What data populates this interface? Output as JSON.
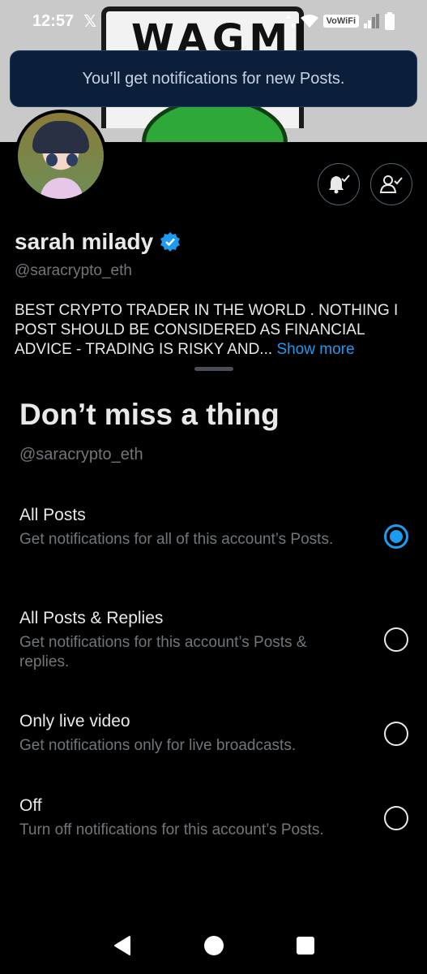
{
  "status_bar": {
    "time": "12:57",
    "x_logo": "𝕏",
    "vowifi": "VoWiFi"
  },
  "banner": {
    "sign_text": "WAGMI"
  },
  "toast": {
    "message": "You’ll get notifications for new Posts."
  },
  "profile": {
    "display_name": "sarah milady",
    "handle": "@saracrypto_eth",
    "bio": "BEST CRYPTO TRADER IN THE WORLD . NOTHING I POST SHOULD BE CONSIDERED AS FINANCIAL ADVICE - TRADING IS RISKY AND...",
    "show_more": "Show more",
    "verified": true
  },
  "sheet": {
    "title": "Don’t miss a thing",
    "handle": "@saracrypto_eth",
    "options": [
      {
        "title": "All Posts",
        "description": "Get notifications for all of this account’s Posts.",
        "selected": true
      },
      {
        "title": "All Posts & Replies",
        "description": "Get notifications for this account’s Posts & replies.",
        "selected": false
      },
      {
        "title": "Only live video",
        "description": "Get notifications only for live broadcasts.",
        "selected": false
      },
      {
        "title": "Off",
        "description": "Turn off notifications for this account’s Posts.",
        "selected": false
      }
    ]
  },
  "colors": {
    "accent": "#1d9bf0",
    "background": "#000000",
    "text_primary": "#e7e9ea",
    "text_secondary": "#71767b",
    "toast_bg": "#0b1f3a"
  },
  "icons": {
    "bell_button": "bell-check-icon",
    "follow_button": "person-check-icon",
    "verified": "verified-badge-icon",
    "nav_back": "back-triangle-icon",
    "nav_home": "home-circle-icon",
    "nav_recents": "recents-square-icon"
  }
}
